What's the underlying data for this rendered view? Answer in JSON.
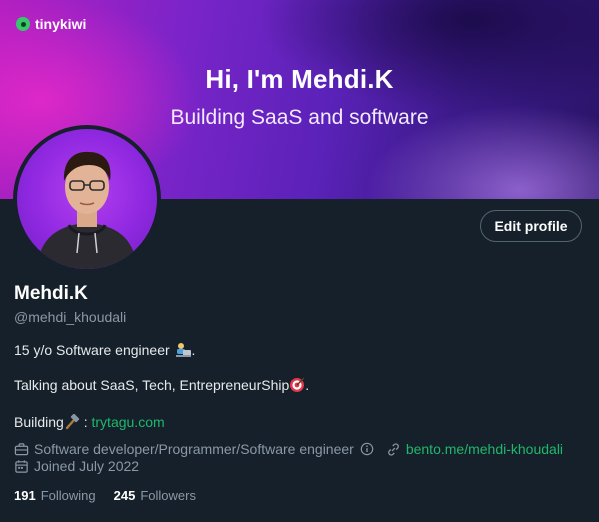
{
  "banner": {
    "brand": "tinykiwi",
    "title": "Hi, I'm Mehdi.K",
    "subtitle": "Building SaaS and software"
  },
  "profile": {
    "edit_button": "Edit profile",
    "name": "Mehdi.K",
    "handle": "@mehdi_khoudali",
    "bio": {
      "line1": "15 y/o Software engineer",
      "line1_suffix": ".",
      "line2": "Talking about SaaS, Tech, EntrepreneurShip",
      "line2_suffix": ".",
      "line3_prefix": "Building",
      "line3_separator": " : ",
      "line3_link": "trytagu.com"
    },
    "profession": "Software developer/Programmer/Software engineer",
    "website": "bento.me/mehdi-khoudali",
    "joined": "Joined July 2022",
    "following_count": "191",
    "following_label": "Following",
    "followers_count": "245",
    "followers_label": "Followers"
  },
  "colors": {
    "background": "#15202b",
    "accent_link": "#1fb86b",
    "secondary_text": "#8b98a5"
  },
  "icons": [
    "kiwi-logo-icon",
    "briefcase-icon",
    "info-icon",
    "link-icon",
    "calendar-icon",
    "technologist-emoji",
    "target-emoji",
    "hammer-emoji"
  ]
}
